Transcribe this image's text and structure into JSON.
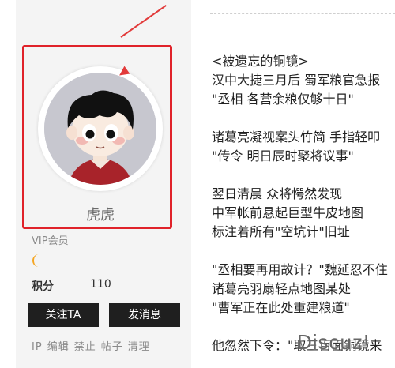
{
  "profile": {
    "username": "虎虎",
    "group": "VIP会员",
    "level_icon": "moon-icon",
    "points_label": "积分",
    "points_value": "110",
    "follow_label": "关注TA",
    "message_label": "发消息",
    "admin_links": [
      "IP",
      "编辑",
      "禁止",
      "帖子",
      "清理"
    ]
  },
  "post": {
    "lines": [
      "<被遗忘的铜镜>",
      "汉中大捷三月后 蜀军粮官急报",
      "\"丞相 各营余粮仅够十日\"",
      "",
      "诸葛亮凝视案头竹简 手指轻叩",
      "\"传令 明日辰时聚将议事\"",
      "",
      "翌日清晨 众将愕然发现",
      "中军帐前悬起巨型牛皮地图",
      "标注着所有\"空坑计\"旧址",
      "",
      "\"丞相要再用故计？\"魏延忍不住",
      "诸葛亮羽扇轻点地图某处",
      "\"曹军正在此处重建粮道\"",
      "",
      "他忽然下令：\"取三百面铜镜来"
    ]
  },
  "watermark": "Discuz!",
  "colors": {
    "highlight": "#e0222a",
    "button_bg": "#1f1f1f",
    "sidebar_bg": "#f4f4f4",
    "moon": "#f5a623"
  }
}
